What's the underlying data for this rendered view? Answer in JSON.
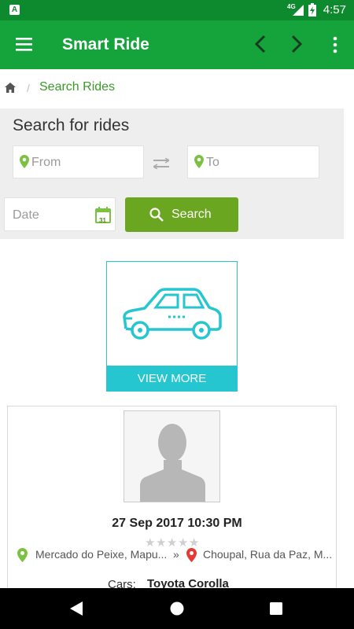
{
  "status_bar": {
    "time": "4:57",
    "network": "4G",
    "app_badge": "A"
  },
  "app_bar": {
    "title": "Smart Ride",
    "icons": [
      "menu-icon",
      "chevron-left-icon",
      "chevron-right-icon",
      "more-vert-icon"
    ]
  },
  "breadcrumb": {
    "separator": "/",
    "current": "Search Rides"
  },
  "search": {
    "heading": "Search for rides",
    "from_placeholder": "From",
    "to_placeholder": "To",
    "date_placeholder": "Date",
    "calendar_day": "31",
    "button_label": "Search"
  },
  "promo": {
    "view_more_label": "VIEW MORE"
  },
  "ride": {
    "datetime": "27 Sep 2017 10:30 PM",
    "rating_stars": 0,
    "rating_max": 5,
    "origin": "Mercado do Peixe, Mapu...",
    "arrow": "»",
    "destination": "Choupal, Rua da Paz, M...",
    "cars_label": "Cars:",
    "car_model": "Toyota Corolla"
  },
  "colors": {
    "status_bar": "#0e8a2e",
    "app_bar": "#15a33b",
    "search_button": "#6aa61f",
    "accent_teal": "#25c6cf",
    "pin_green": "#7cc242",
    "pin_red": "#e53935"
  }
}
